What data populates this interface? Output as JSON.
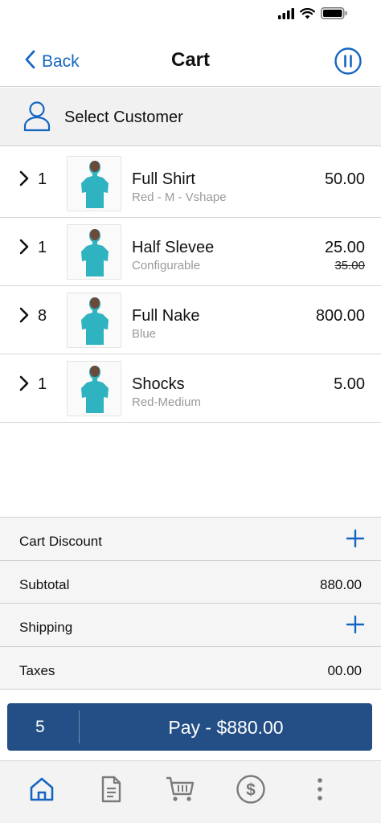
{
  "status_bar": {
    "icons": [
      "signal-icon",
      "wifi-icon",
      "battery-icon"
    ]
  },
  "nav": {
    "back_label": "Back",
    "title": "Cart",
    "accent_color": "#1565c0"
  },
  "customer": {
    "label": "Select Customer"
  },
  "items": [
    {
      "qty": "1",
      "name": "Full Shirt",
      "variant": "Red - M - Vshape",
      "price": "50.00",
      "original_price": ""
    },
    {
      "qty": "1",
      "name": "Half Slevee",
      "variant": "Configurable",
      "price": "25.00",
      "original_price": "35.00"
    },
    {
      "qty": "8",
      "name": "Full Nake",
      "variant": "Blue",
      "price": "800.00",
      "original_price": ""
    },
    {
      "qty": "1",
      "name": "Shocks",
      "variant": "Red-Medium",
      "price": "5.00",
      "original_price": ""
    }
  ],
  "summary": {
    "cart_discount": {
      "label": "Cart Discount"
    },
    "subtotal": {
      "label": "Subtotal",
      "value": "880.00"
    },
    "shipping": {
      "label": "Shipping"
    },
    "taxes": {
      "label": "Taxes",
      "value": "00.00"
    }
  },
  "pay": {
    "count": "5",
    "label": "Pay - $880.00",
    "color": "#234f86"
  },
  "tabs": [
    {
      "icon": "home-icon",
      "active": true
    },
    {
      "icon": "document-icon",
      "active": false
    },
    {
      "icon": "cart-icon",
      "active": false
    },
    {
      "icon": "dollar-icon",
      "active": false
    },
    {
      "icon": "more-icon",
      "active": false
    }
  ]
}
